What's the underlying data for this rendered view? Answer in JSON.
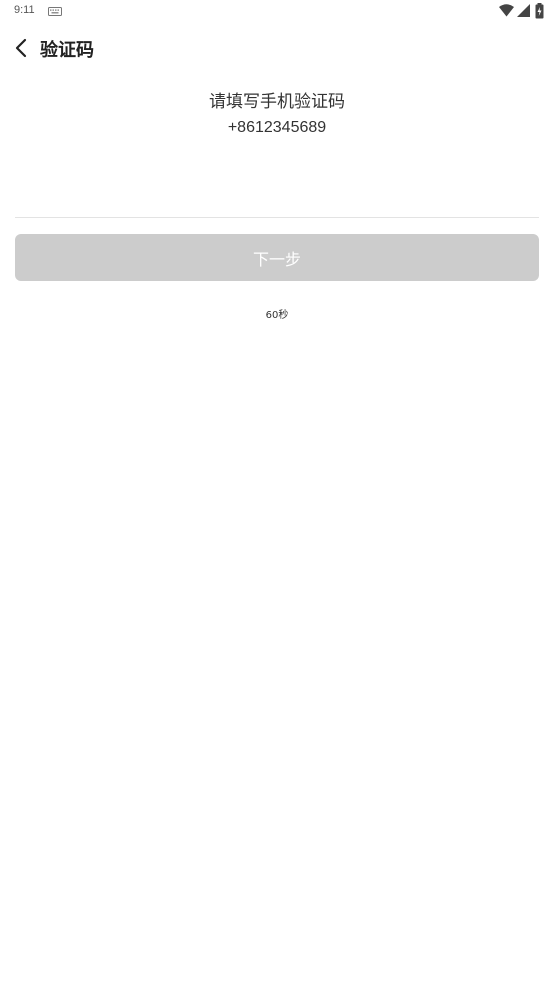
{
  "status_bar": {
    "time": "9:11",
    "icons": [
      "keyboard-icon",
      "wifi-icon",
      "signal-icon",
      "battery-icon"
    ]
  },
  "header": {
    "back_icon": "chevron-left-icon",
    "title": "验证码"
  },
  "main": {
    "instruction": "请填写手机验证码",
    "phone_number": "+8612345689",
    "code_input": {
      "value": "",
      "placeholder": ""
    },
    "next_label": "下一步",
    "countdown": "60秒"
  },
  "colors": {
    "button_disabled": "#cccccc",
    "text_primary": "#333333",
    "divider": "#e3e3e3"
  }
}
